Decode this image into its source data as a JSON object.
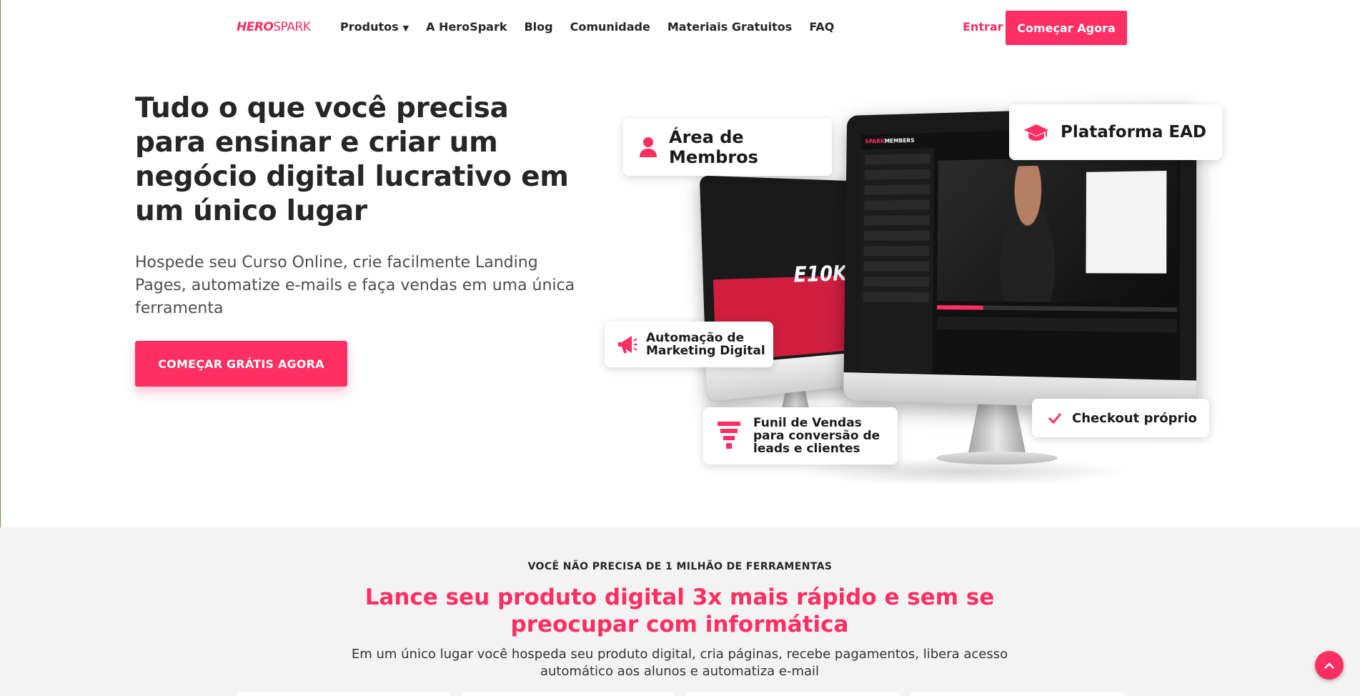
{
  "brand": {
    "logo_hero": "HERO",
    "logo_spark": "SPARK",
    "accent": "#ff2e63"
  },
  "nav": {
    "items": [
      {
        "label": "Produtos",
        "has_dropdown": true
      },
      {
        "label": "A HeroSpark"
      },
      {
        "label": "Blog"
      },
      {
        "label": "Comunidade"
      },
      {
        "label": "Materiais Gratuitos"
      },
      {
        "label": "FAQ"
      }
    ],
    "login_label": "Entrar",
    "cta_label": "Começar Agora"
  },
  "hero": {
    "title": "Tudo o que você precisa para ensinar e criar um negócio digital lucrativo em um único lugar",
    "subtitle": "Hospede seu Curso Online, crie facilmente Landing Pages, automatize e-mails e faça vendas em uma única ferramenta",
    "cta_label": "COMEÇAR GRÁTIS AGORA"
  },
  "features": {
    "membros": {
      "label": "Área de Membros",
      "icon": "user-icon"
    },
    "ead": {
      "label": "Plataforma EAD",
      "icon": "graduation-cap-icon"
    },
    "automacao": {
      "line1": "Automação de",
      "line2": "Marketing Digital",
      "icon": "megaphone-icon"
    },
    "funil": {
      "line1": "Funil de Vendas",
      "line2": "para conversão de",
      "line3": "leads e clientes",
      "icon": "funnel-icon"
    },
    "checkout": {
      "label": "Checkout próprio",
      "icon": "check-icon"
    }
  },
  "mockup": {
    "big_brand_a": "SPARK",
    "big_brand_b": "MEMBERS",
    "small_badge": "E10K"
  },
  "section2": {
    "kicker": "VOCÊ NÃO PRECISA DE 1 MILHÃO DE FERRAMENTAS",
    "title": "Lance seu produto digital 3x mais rápido e sem se preocupar com informática",
    "text": "Em um único lugar você hospeda seu produto digital, cria páginas, recebe pagamentos, libera acesso automático aos alunos e automatiza e-mail"
  },
  "scroll_top": {
    "icon": "chevron-up-icon"
  }
}
